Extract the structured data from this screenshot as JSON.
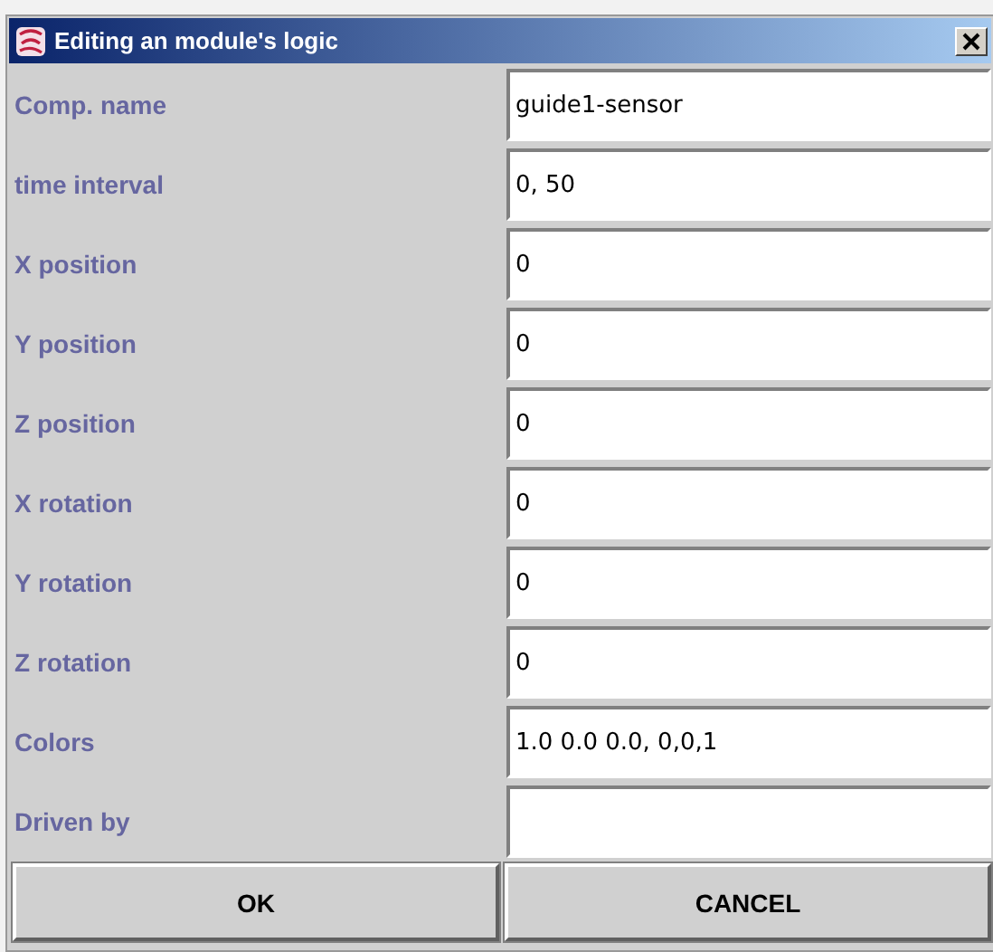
{
  "window": {
    "title": "Editing an module's logic"
  },
  "fields": [
    {
      "label": "Comp. name",
      "value": "guide1-sensor"
    },
    {
      "label": "time interval",
      "value": "0, 50"
    },
    {
      "label": "X position",
      "value": "0"
    },
    {
      "label": "Y position",
      "value": "0"
    },
    {
      "label": "Z position",
      "value": "0"
    },
    {
      "label": "X rotation",
      "value": "0"
    },
    {
      "label": "Y rotation",
      "value": "0"
    },
    {
      "label": "Z rotation",
      "value": "0"
    },
    {
      "label": "Colors",
      "value": "1.0 0.0 0.0, 0,0,1"
    },
    {
      "label": "Driven by"
    }
  ],
  "buttons": [
    "OK",
    "CANCEL"
  ]
}
